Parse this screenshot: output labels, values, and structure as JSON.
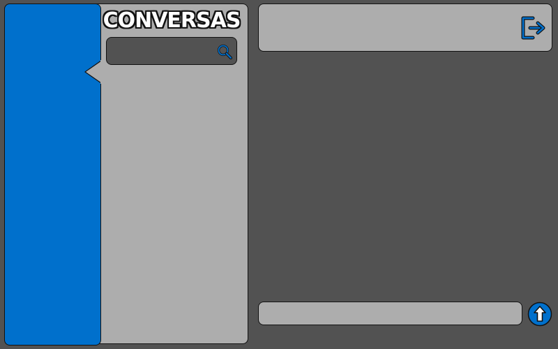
{
  "sidebar": {
    "accent_color": "#0070cc"
  },
  "conversations": {
    "title": "CONVERSAS",
    "search": {
      "value": "",
      "placeholder": "",
      "icon": "search-icon"
    },
    "items": []
  },
  "header": {
    "logout_icon": "logout-icon"
  },
  "composer": {
    "value": "",
    "placeholder": "",
    "send_icon": "arrow-up-icon"
  },
  "colors": {
    "background": "#525252",
    "panel": "#adadad",
    "accent": "#0070cc",
    "outline": "#111111"
  }
}
